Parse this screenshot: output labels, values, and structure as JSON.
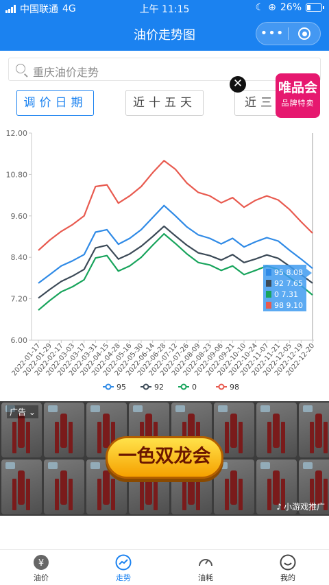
{
  "status_bar": {
    "carrier": "中国联通",
    "network": "4G",
    "time": "上午 11:15",
    "battery": "26%",
    "battery_level": 0.26
  },
  "header": {
    "title": "油价走势图",
    "more_icon": "more-dots-icon",
    "close_icon": "target-circle-icon"
  },
  "search": {
    "placeholder": "重庆油价走势"
  },
  "tabs": [
    {
      "label": "调价日期",
      "active": true
    },
    {
      "label": "近十五天",
      "active": false
    },
    {
      "label": "近三十天",
      "active": false
    }
  ],
  "vip_ad": {
    "line1": "唯品会",
    "line2": "品牌特卖",
    "color": "#e6186f"
  },
  "chart_data": {
    "type": "line",
    "ylim": [
      6.0,
      12.0
    ],
    "yticks": [
      "12.00",
      "10.80",
      "9.60",
      "8.40",
      "7.20",
      "6.00"
    ],
    "grid": false,
    "legend_position": "bottom",
    "x": [
      "2022-01-17",
      "2022-01-29",
      "2022-02-17",
      "2022-03-03",
      "2022-03-17",
      "2022-03-31",
      "2022-04-15",
      "2022-04-28",
      "2022-05-16",
      "2022-05-30",
      "2022-06-14",
      "2022-06-28",
      "2022-07-12",
      "2022-07-26",
      "2022-08-09",
      "2022-08-23",
      "2022-09-06",
      "2022-09-21",
      "2022-10-10",
      "2022-10-24",
      "2022-11-07",
      "2022-11-21",
      "2022-12-05",
      "2022-12-19",
      "2022-12-20"
    ],
    "series": [
      {
        "name": "95",
        "color": "#2f8ae6",
        "values": [
          7.65,
          7.9,
          8.15,
          8.3,
          8.48,
          9.13,
          9.2,
          8.78,
          8.95,
          9.2,
          9.55,
          9.9,
          9.6,
          9.28,
          9.05,
          8.95,
          8.79,
          8.95,
          8.7,
          8.85,
          8.97,
          8.87,
          8.6,
          8.35,
          8.08
        ]
      },
      {
        "name": "92",
        "color": "#3c4a57",
        "values": [
          7.22,
          7.47,
          7.7,
          7.86,
          8.05,
          8.67,
          8.75,
          8.35,
          8.5,
          8.72,
          9.0,
          9.3,
          9.02,
          8.75,
          8.53,
          8.45,
          8.32,
          8.48,
          8.25,
          8.35,
          8.47,
          8.37,
          8.14,
          7.9,
          7.65
        ]
      },
      {
        "name": "0",
        "color": "#18a45c",
        "values": [
          6.87,
          7.15,
          7.4,
          7.55,
          7.75,
          8.38,
          8.45,
          8.0,
          8.15,
          8.4,
          8.75,
          9.08,
          8.8,
          8.5,
          8.25,
          8.18,
          8.02,
          8.15,
          7.9,
          8.02,
          8.15,
          8.05,
          7.81,
          7.58,
          7.31
        ]
      },
      {
        "name": "98",
        "color": "#e85a4f",
        "values": [
          8.6,
          8.9,
          9.15,
          9.35,
          9.6,
          10.45,
          10.5,
          9.97,
          10.18,
          10.45,
          10.85,
          11.2,
          10.95,
          10.55,
          10.28,
          10.18,
          9.98,
          10.13,
          9.85,
          10.05,
          10.18,
          10.06,
          9.78,
          9.43,
          9.1
        ]
      }
    ],
    "tooltip": {
      "lines": [
        "95 8.08",
        "92 7.65",
        "0 7.31",
        "98 9.10"
      ]
    }
  },
  "ad_banner": {
    "label": "广告",
    "button_text": "一色双龙会",
    "source": "小游戏推广"
  },
  "tabbar": [
    {
      "label": "油价",
      "icon": "yen-coin-icon",
      "active": false
    },
    {
      "label": "走势",
      "icon": "trend-chart-icon",
      "active": true
    },
    {
      "label": "油耗",
      "icon": "gauge-icon",
      "active": false
    },
    {
      "label": "我的",
      "icon": "smiley-face-icon",
      "active": false
    }
  ]
}
